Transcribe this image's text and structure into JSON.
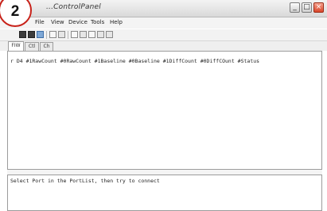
{
  "badge": {
    "number": "2"
  },
  "window": {
    "title": "...ControlPanel",
    "controls": {
      "minimize": "_",
      "maximize": "□",
      "close": "×"
    }
  },
  "menubar": {
    "items": [
      "File",
      "View",
      "Device",
      "Tools",
      "Help"
    ]
  },
  "toolbar": {
    "icons": [
      "connect-icon",
      "disconnect-icon",
      "save-icon",
      "refresh-icon",
      "settings-icon",
      "list-icon",
      "chart-icon",
      "reset-icon",
      "start-icon",
      "stop-icon"
    ]
  },
  "tabs": [
    {
      "label": "FIW"
    },
    {
      "label": "Ctl"
    },
    {
      "label": "Ch"
    }
  ],
  "main": {
    "header_line": "r D4 #1RawCount #0RawCount #1Baseline #0Baseline #1DiffCount #0DiffCOunt #Status"
  },
  "messages": {
    "text": "Select Port in the PortList, then try to connect"
  },
  "colors": {
    "badge_ring": "#c8221a",
    "close_button": "#d9462a"
  }
}
